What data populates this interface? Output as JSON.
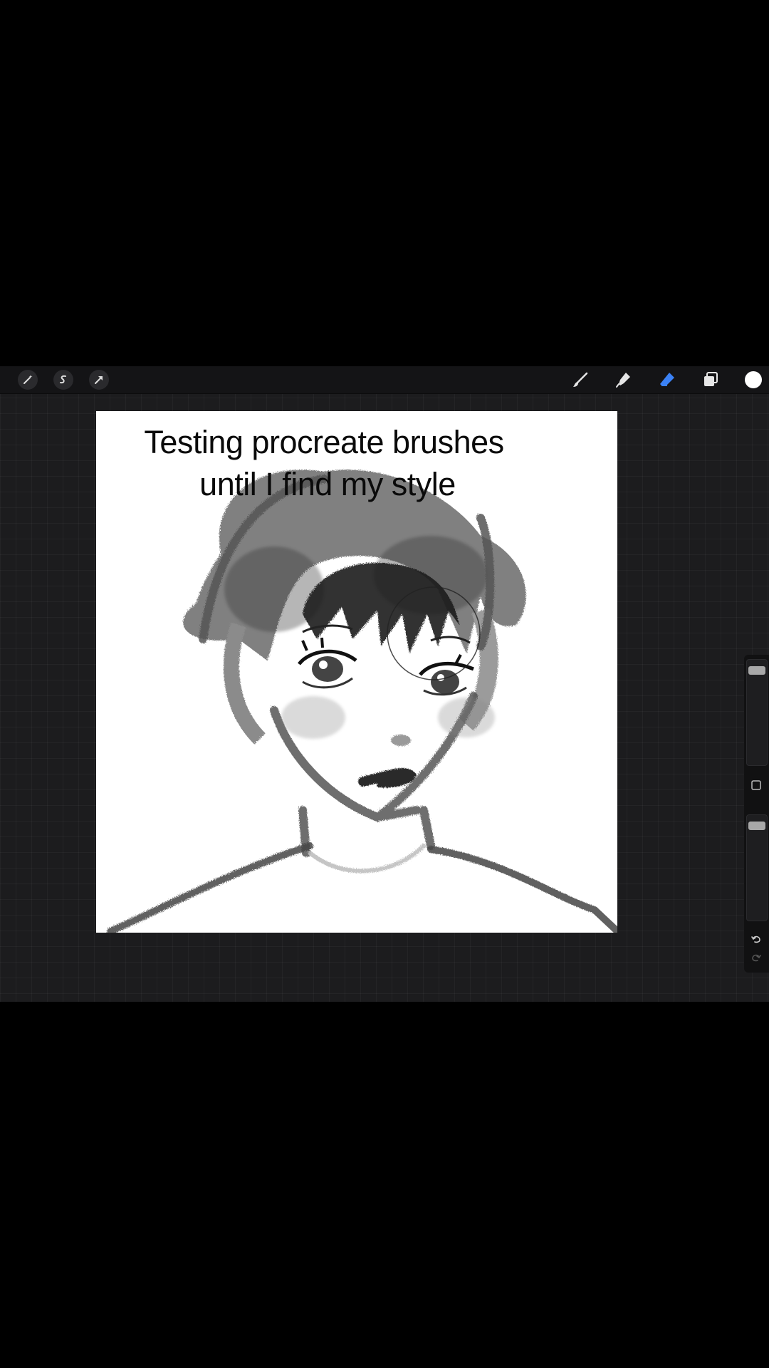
{
  "caption": {
    "line1": "Testing procreate brushes",
    "line2": "until I find my style"
  },
  "toolbar": {
    "left_icons": [
      "adjustments-icon",
      "selection-icon",
      "transform-icon"
    ],
    "right_icons": [
      "brush-icon",
      "smudge-icon",
      "eraser-icon",
      "layers-icon",
      "color-icon"
    ],
    "active_tool": "eraser",
    "accent": "#3b82f6",
    "current_color": "#ffffff"
  },
  "sidebar": {
    "size_slider_level": 0.95,
    "opacity_slider_level": 0.95
  }
}
